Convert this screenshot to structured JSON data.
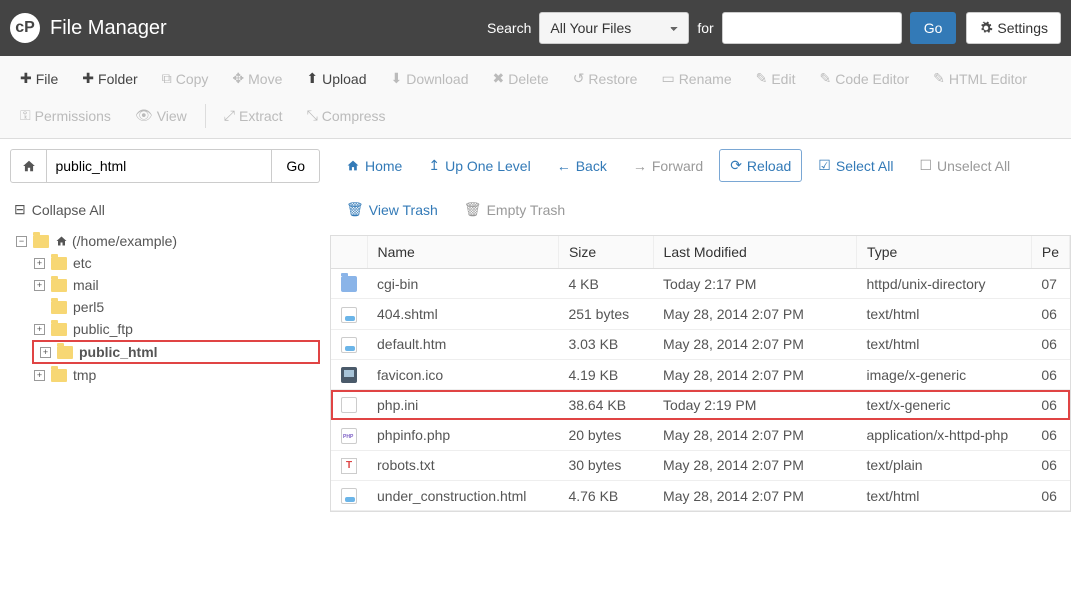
{
  "header": {
    "title": "File Manager",
    "search_label": "Search",
    "search_select": "All Your Files",
    "for_label": "for",
    "search_value": "",
    "go": "Go",
    "settings": "Settings"
  },
  "toolbar": {
    "file": "File",
    "folder": "Folder",
    "copy": "Copy",
    "move": "Move",
    "upload": "Upload",
    "download": "Download",
    "delete": "Delete",
    "restore": "Restore",
    "rename": "Rename",
    "edit": "Edit",
    "code_editor": "Code Editor",
    "html_editor": "HTML Editor",
    "permissions": "Permissions",
    "view": "View",
    "extract": "Extract",
    "compress": "Compress"
  },
  "pathbar": {
    "value": "public_html",
    "go": "Go"
  },
  "collapse_all": "Collapse All",
  "tree": {
    "root": "(/home/example)",
    "items": [
      {
        "name": "etc",
        "expandable": true
      },
      {
        "name": "mail",
        "expandable": true
      },
      {
        "name": "perl5",
        "expandable": false
      },
      {
        "name": "public_ftp",
        "expandable": true
      },
      {
        "name": "public_html",
        "expandable": true,
        "selected": true
      },
      {
        "name": "tmp",
        "expandable": true
      }
    ]
  },
  "navbar": {
    "home": "Home",
    "up": "Up One Level",
    "back": "Back",
    "forward": "Forward",
    "reload": "Reload",
    "select_all": "Select All",
    "unselect_all": "Unselect All",
    "view_trash": "View Trash",
    "empty_trash": "Empty Trash"
  },
  "table": {
    "headers": {
      "name": "Name",
      "size": "Size",
      "last_modified": "Last Modified",
      "type": "Type",
      "perm": "Pe"
    },
    "rows": [
      {
        "icon": "folder",
        "name": "cgi-bin",
        "size": "4 KB",
        "lm": "Today 2:17 PM",
        "type": "httpd/unix-directory",
        "perm": "07"
      },
      {
        "icon": "html",
        "name": "404.shtml",
        "size": "251 bytes",
        "lm": "May 28, 2014 2:07 PM",
        "type": "text/html",
        "perm": "06"
      },
      {
        "icon": "html",
        "name": "default.htm",
        "size": "3.03 KB",
        "lm": "May 28, 2014 2:07 PM",
        "type": "text/html",
        "perm": "06"
      },
      {
        "icon": "ico",
        "name": "favicon.ico",
        "size": "4.19 KB",
        "lm": "May 28, 2014 2:07 PM",
        "type": "image/x-generic",
        "perm": "06"
      },
      {
        "icon": "txt",
        "name": "php.ini",
        "size": "38.64 KB",
        "lm": "Today 2:19 PM",
        "type": "text/x-generic",
        "perm": "06",
        "highlight": true
      },
      {
        "icon": "php",
        "name": "phpinfo.php",
        "size": "20 bytes",
        "lm": "May 28, 2014 2:07 PM",
        "type": "application/x-httpd-php",
        "perm": "06"
      },
      {
        "icon": "robot",
        "name": "robots.txt",
        "size": "30 bytes",
        "lm": "May 28, 2014 2:07 PM",
        "type": "text/plain",
        "perm": "06"
      },
      {
        "icon": "html",
        "name": "under_construction.html",
        "size": "4.76 KB",
        "lm": "May 28, 2014 2:07 PM",
        "type": "text/html",
        "perm": "06"
      }
    ]
  }
}
